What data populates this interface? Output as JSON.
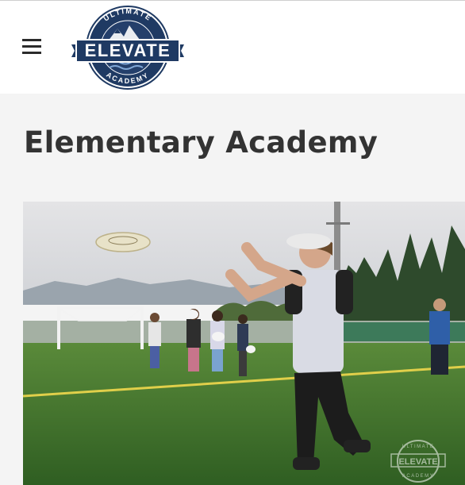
{
  "header": {
    "menu_icon": "hamburger-menu-icon",
    "logo": {
      "wordmark": "ELEVATE",
      "top_arc": "ULTIMATE",
      "bottom_arc": "ACADEMY"
    }
  },
  "page": {
    "title": "Elementary Academy"
  },
  "hero": {
    "watermark": {
      "wordmark": "ELEVATE",
      "top_arc": "ULTIMATE",
      "bottom_arc": "ACADEMY"
    }
  },
  "colors": {
    "brand_navy": "#1f3a63",
    "header_bg": "#ffffff",
    "page_bg": "#f4f4f4",
    "title_text": "#333333"
  }
}
